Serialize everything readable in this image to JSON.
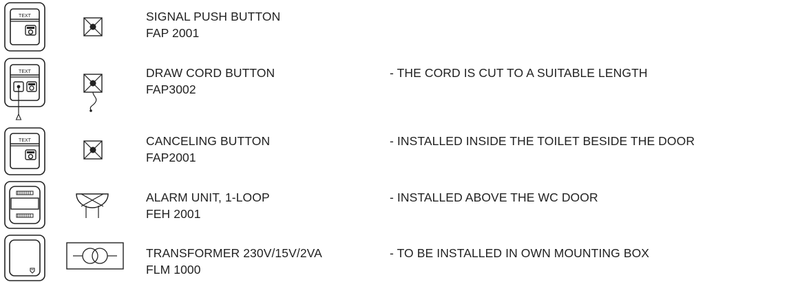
{
  "rows": [
    {
      "name": "SIGNAL PUSH BUTTON",
      "code": "FAP 2001",
      "note": "",
      "device_label": "TEXT"
    },
    {
      "name": "DRAW CORD BUTTON",
      "code": "FAP3002",
      "note": "- THE CORD IS CUT TO A SUITABLE LENGTH",
      "device_label": "TEXT"
    },
    {
      "name": "CANCELING BUTTON",
      "code": "FAP2001",
      "note": "- INSTALLED INSIDE THE TOILET BESIDE THE DOOR",
      "device_label": "TEXT"
    },
    {
      "name": "ALARM UNIT, 1-LOOP",
      "code": "FEH 2001",
      "note": "- INSTALLED ABOVE THE WC DOOR"
    },
    {
      "name": "TRANSFORMER 230V/15V/2VA",
      "code": "FLM 1000",
      "note": "- TO BE INSTALLED IN OWN MOUNTING BOX"
    }
  ]
}
